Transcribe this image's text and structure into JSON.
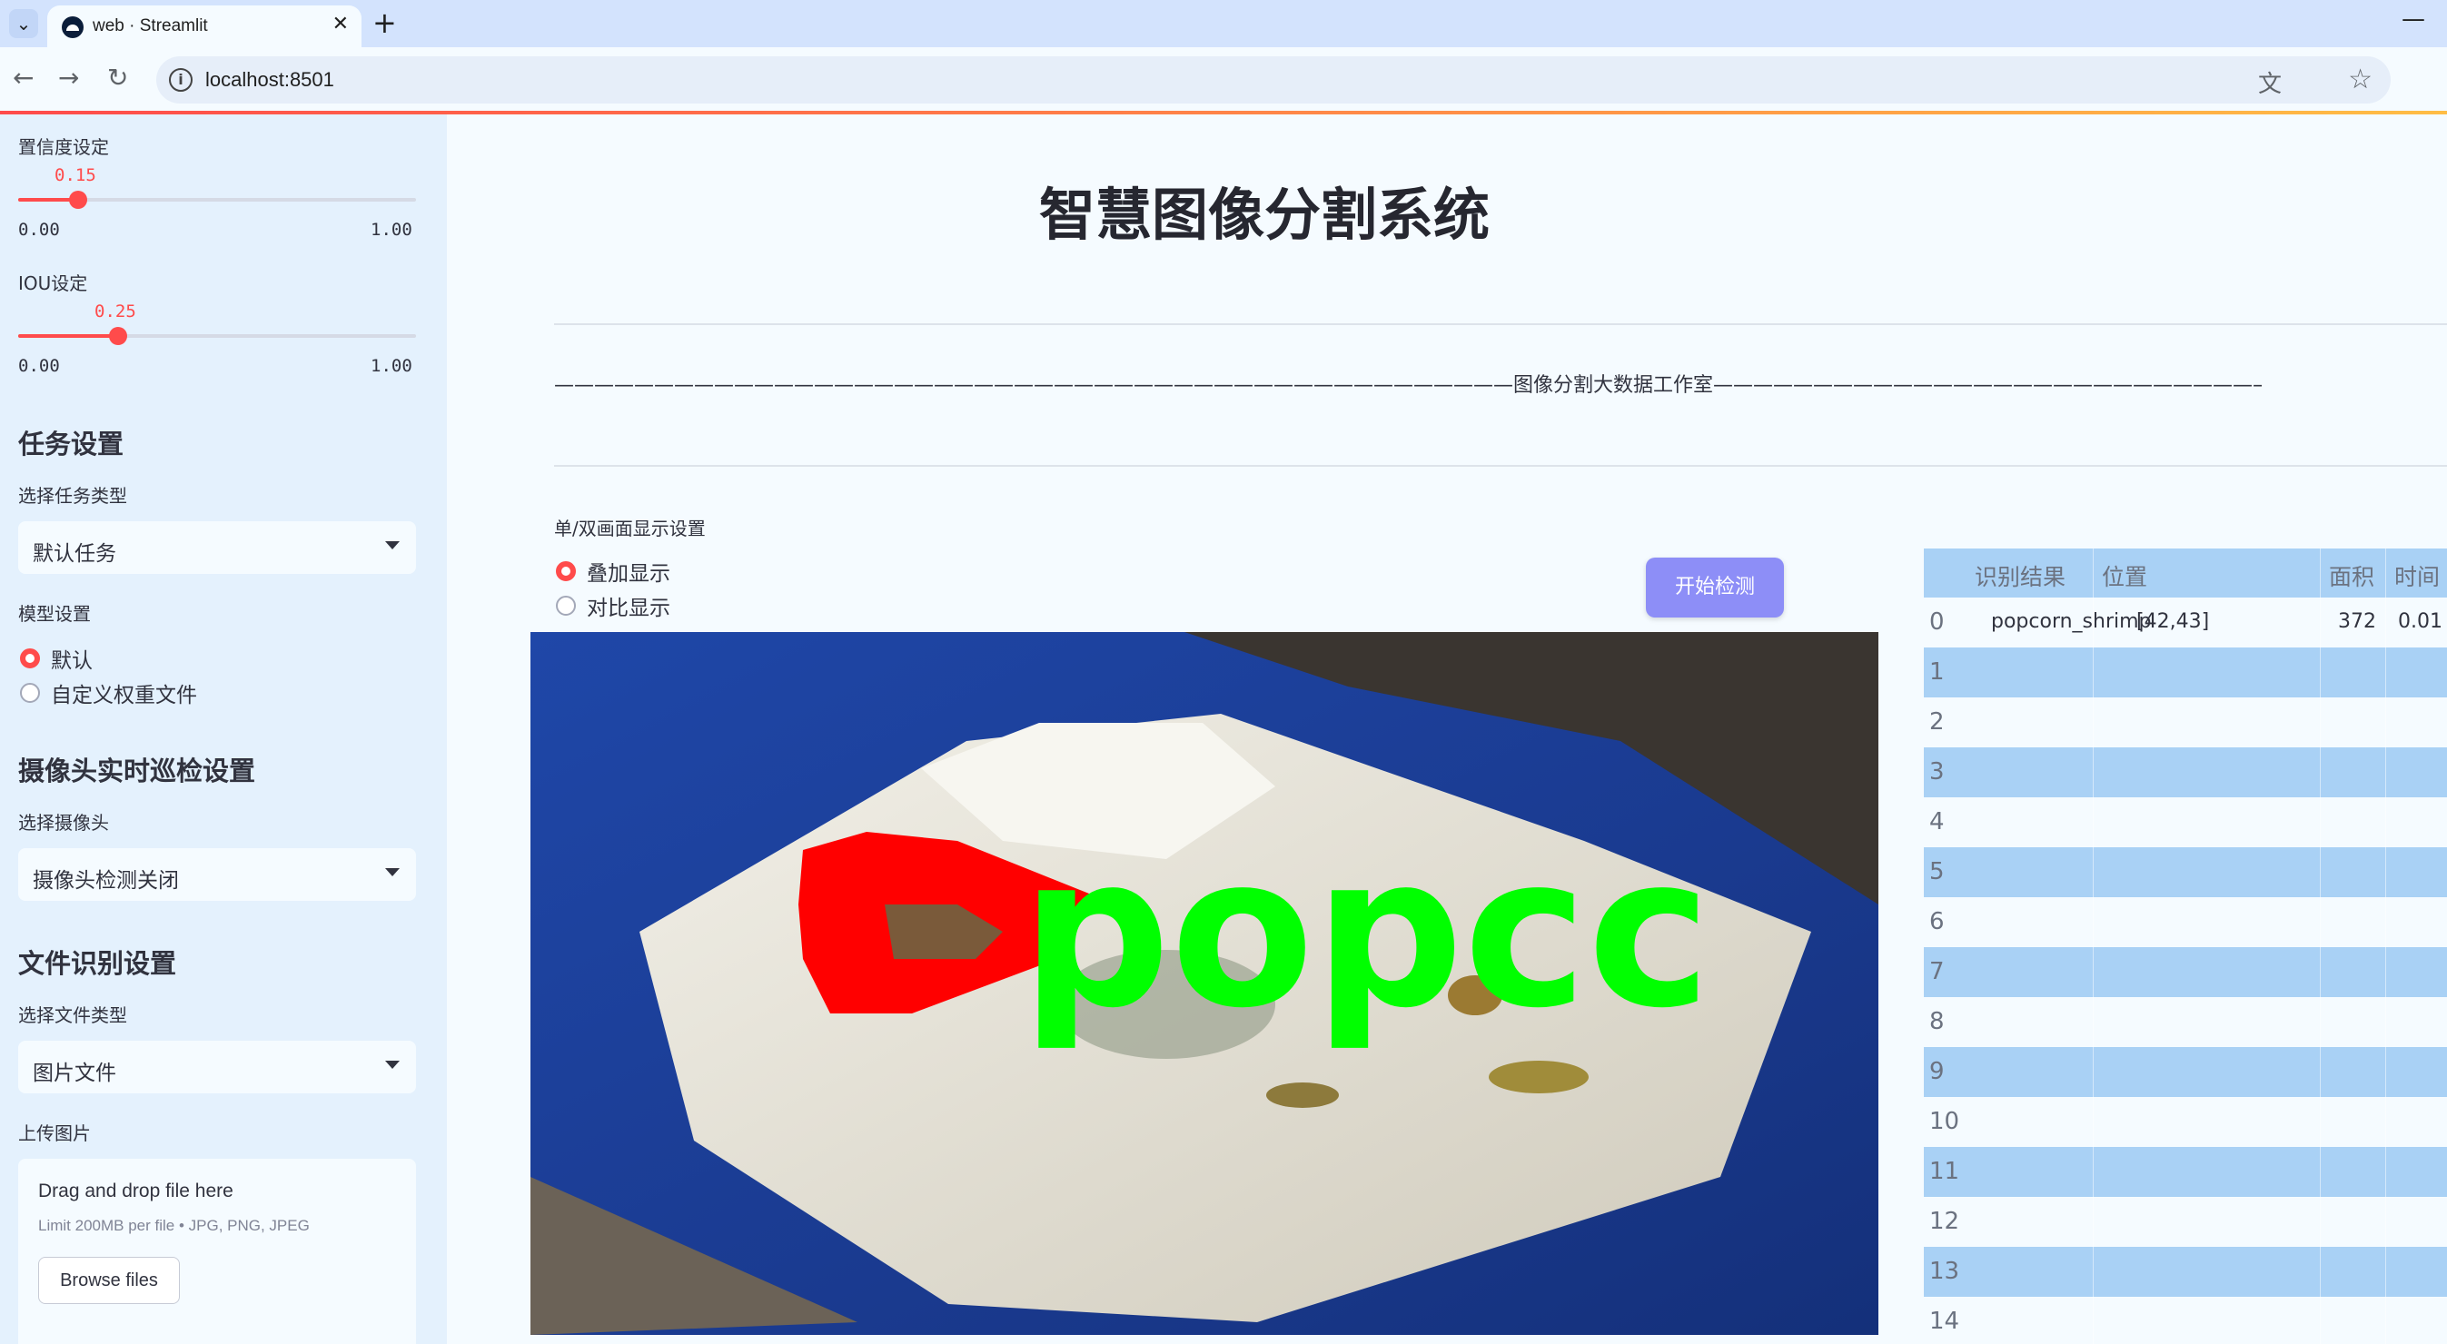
{
  "browser": {
    "tab_title": "web · Streamlit",
    "url": "localhost:8501"
  },
  "sidebar": {
    "confidence": {
      "label": "置信度设定",
      "value": "0.15",
      "value_num": 0.15,
      "min": "0.00",
      "max": "1.00"
    },
    "iou": {
      "label": "IOU设定",
      "value": "0.25",
      "value_num": 0.25,
      "min": "0.00",
      "max": "1.00"
    },
    "task_header": "任务设置",
    "task_type_label": "选择任务类型",
    "task_type_value": "默认任务",
    "model_label": "模型设置",
    "model_options": [
      "默认",
      "自定义权重文件"
    ],
    "model_selected": "默认",
    "camera_header": "摄像头实时巡检设置",
    "camera_label": "选择摄像头",
    "camera_value": "摄像头检测关闭",
    "file_header": "文件识别设置",
    "file_type_label": "选择文件类型",
    "file_type_value": "图片文件",
    "upload_label": "上传图片",
    "upload": {
      "title": "Drag and drop file here",
      "limit": "Limit 200MB per file • JPG, PNG, JPEG",
      "button": "Browse files"
    }
  },
  "main": {
    "title": "智慧图像分割系统",
    "banner": "————————————————————————————————————————————————图像分割大数据工作室————————————————————————————————————————————————",
    "display_label": "单/双画面显示设置",
    "display_options": [
      "叠加显示",
      "对比显示"
    ],
    "display_selected": "叠加显示",
    "start_button": "开始检测",
    "overlay_text": "popcorn_shrimp",
    "overlay_visible": "popcc"
  },
  "table": {
    "headers": [
      "识别结果",
      "位置",
      "面积",
      "时间"
    ],
    "rows": [
      {
        "idx": "0",
        "result": "popcorn_shrimp",
        "position": "[42,43]",
        "area": "372",
        "time": "0.01"
      },
      {
        "idx": "1"
      },
      {
        "idx": "2"
      },
      {
        "idx": "3"
      },
      {
        "idx": "4"
      },
      {
        "idx": "5"
      },
      {
        "idx": "6"
      },
      {
        "idx": "7"
      },
      {
        "idx": "8"
      },
      {
        "idx": "9"
      },
      {
        "idx": "10"
      },
      {
        "idx": "11"
      },
      {
        "idx": "12"
      },
      {
        "idx": "13"
      },
      {
        "idx": "14"
      }
    ]
  },
  "colors": {
    "accent": "#ff4b4b",
    "button": "#8d8ef7",
    "sidebar_bg": "#e4f1fd",
    "table_stripe": "#a9d1f5",
    "mask": "#ff0000",
    "label_text": "#00ff00"
  }
}
